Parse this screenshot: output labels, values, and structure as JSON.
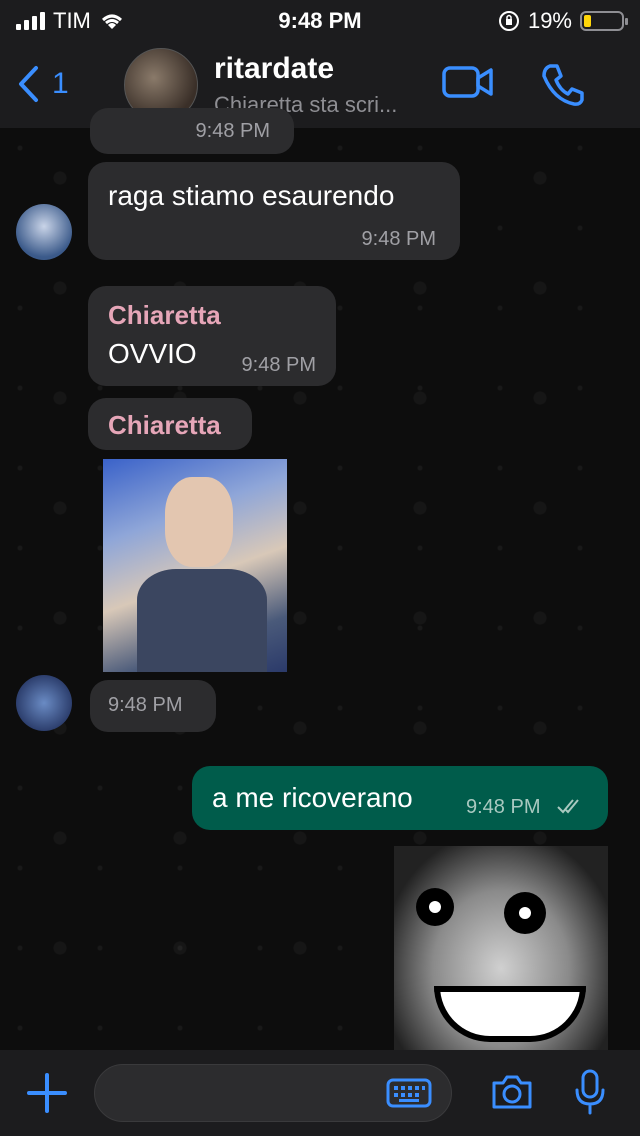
{
  "status_bar": {
    "carrier": "TIM",
    "time": "9:48 PM",
    "battery": "19%",
    "battery_level": 0.19
  },
  "header": {
    "back_count": "1",
    "title": "ritardate",
    "subtitle": "Chiaretta sta scri...",
    "icons": [
      "chevron-left-icon",
      "video-call-icon",
      "phone-icon"
    ]
  },
  "messages": [
    {
      "kind": "in",
      "text": "",
      "time": "9:48 PM"
    },
    {
      "kind": "in",
      "text": "raga stiamo esaurendo",
      "time": "9:48 PM"
    },
    {
      "kind": "in",
      "sender": "Chiaretta",
      "text": "OVVIO",
      "time": "9:48 PM"
    },
    {
      "kind": "in",
      "sender": "Chiaretta",
      "media": "gif"
    },
    {
      "kind": "in",
      "media_caption_time": "9:48 PM"
    },
    {
      "kind": "out",
      "text": "a me ricoverano",
      "time": "9:48 PM",
      "status": "read"
    },
    {
      "kind": "out",
      "media": "image"
    }
  ],
  "colors": {
    "accent": "#3a8eff",
    "outgoing": "#005c4b",
    "incoming": "#2c2c2e",
    "sender_name": "#e6a6b8"
  },
  "input_bar": {
    "placeholder": "",
    "icons": [
      "plus-icon",
      "keyboard-icon",
      "camera-icon",
      "microphone-icon"
    ]
  }
}
